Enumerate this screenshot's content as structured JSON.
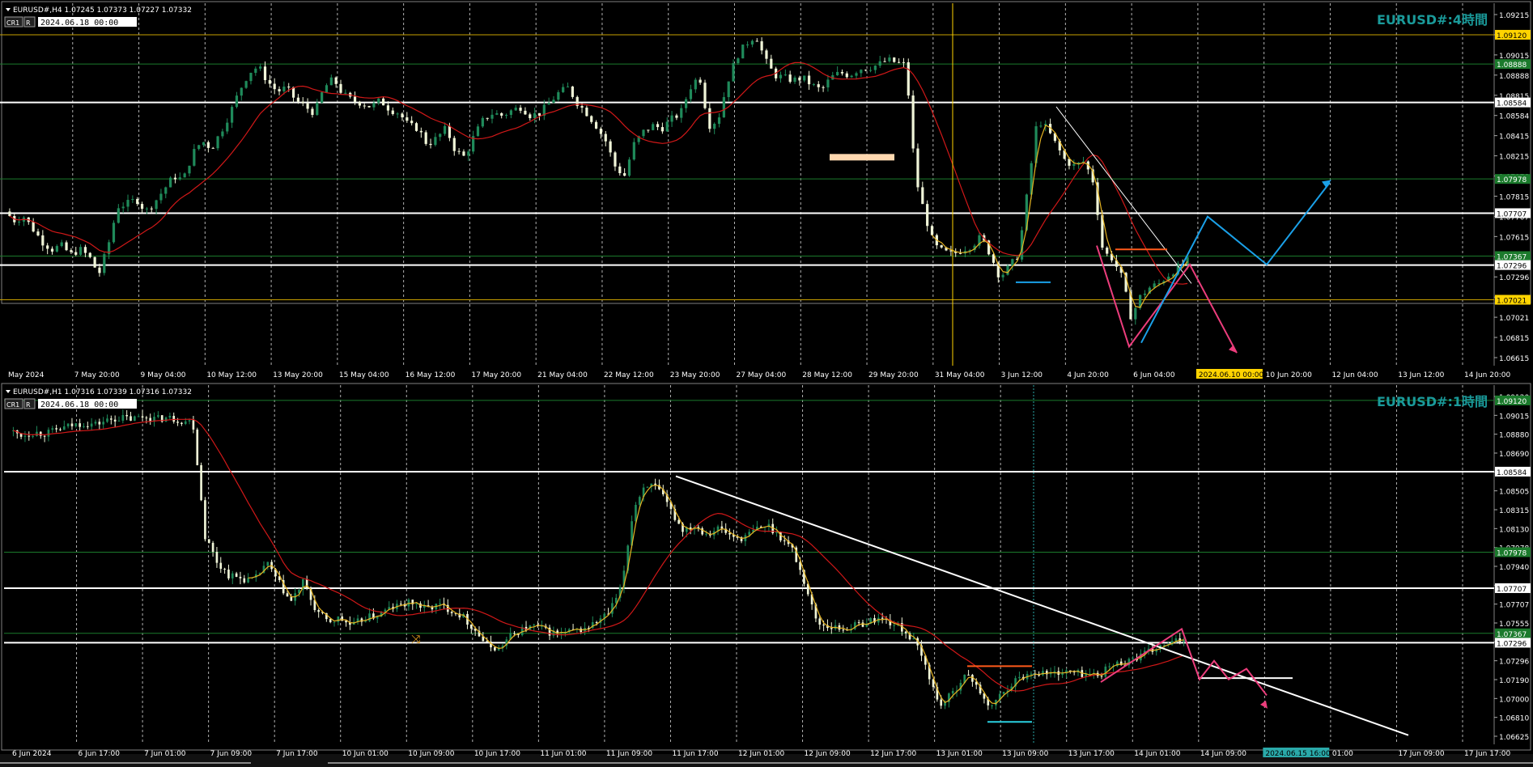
{
  "colors": {
    "background": "#000000",
    "grid": "#cfcfcf",
    "bull": "#1f8a5a",
    "bear": "#f0f5d8",
    "ma_red": "#d01818",
    "zigzag": "#e6b422",
    "level_white": "#ffffff",
    "level_green": "#1b7a2c",
    "level_yellow": "#c8a000",
    "arrow_blue": "#1aa0e8",
    "arrow_pink": "#ec3d7c",
    "orange_line": "#ff5a1a",
    "title_teal": "#1a9a9a",
    "rect_peach": "#ffd8b0"
  },
  "panels": [
    {
      "id": "h4",
      "info": "EURUSD#,H4  1.07245 1.07373 1.07227 1.07332",
      "buttons": [
        "CR1",
        "R"
      ],
      "date_box": "2024.06.18 00:00",
      "title": "EURUSD#:4時間",
      "price_labels": [
        "1.09215",
        "1.09120",
        "1.09015",
        "1.08888",
        "1.08815",
        "1.08584",
        "1.08415",
        "1.08215",
        "1.07978",
        "1.07815",
        "1.07707",
        "1.07615",
        "1.07415",
        "1.07296",
        "1.07215",
        "1.07021",
        "1.06815",
        "1.06615"
      ],
      "time_labels": [
        "May 2024",
        "7 May 20:00",
        "9 May 04:00",
        "10 May 12:00",
        "13 May 20:00",
        "15 May 04:00",
        "16 May 12:00",
        "17 May 20:00",
        "21 May 04:00",
        "22 May 12:00",
        "23 May 20:00",
        "27 May 04:00",
        "28 May 12:00",
        "29 May 20:00",
        "31 May 04:00",
        "3 Jun 12:00",
        "4 Jun 20:00",
        "6 Jun 04:00",
        "2024.06.10 00:00",
        "10 Jun 20:00",
        "12 Jun 04:00",
        "13 Jun 12:00",
        "14 Jun 20:00"
      ],
      "chart_data": {
        "type": "candlestick",
        "symbol": "EURUSD#",
        "timeframe": "H4",
        "ylim": [
          1.0655,
          1.0928
        ],
        "levels": [
          {
            "price": 1.0912,
            "style": "yellow",
            "label": "1.09120"
          },
          {
            "price": 1.08888,
            "style": "green",
            "label": "1.08888"
          },
          {
            "price": 1.08584,
            "style": "white",
            "label": "1.08584"
          },
          {
            "price": 1.07978,
            "style": "green",
            "label": "1.07978"
          },
          {
            "price": 1.07707,
            "style": "white",
            "label": "1.07707"
          },
          {
            "price": 1.07367,
            "style": "green",
            "label": "1.07367"
          },
          {
            "price": 1.07296,
            "style": "white",
            "label": "1.07296"
          },
          {
            "price": 1.07021,
            "style": "yellow",
            "label": "1.07021"
          }
        ],
        "close_path": [
          1.0772,
          1.0765,
          1.0768,
          1.0758,
          1.0748,
          1.0742,
          1.0745,
          1.0738,
          1.0742,
          1.0736,
          1.0722,
          1.0745,
          1.0776,
          1.0778,
          1.0782,
          1.0772,
          1.078,
          1.079,
          1.08,
          1.0797,
          1.0818,
          1.0828,
          1.0822,
          1.0835,
          1.085,
          1.0868,
          1.0882,
          1.0887,
          1.0875,
          1.0867,
          1.087,
          1.086,
          1.0855,
          1.085,
          1.087,
          1.0877,
          1.0865,
          1.086,
          1.0858,
          1.0855,
          1.086,
          1.0853,
          1.085,
          1.084,
          1.0838,
          1.0825,
          1.083,
          1.0838,
          1.082,
          1.0815,
          1.0832,
          1.0845,
          1.085,
          1.0848,
          1.0852,
          1.0855,
          1.0848,
          1.085,
          1.0858,
          1.0866,
          1.087,
          1.0858,
          1.085,
          1.084,
          1.0828,
          1.0808,
          1.08,
          1.0825,
          1.0835,
          1.084,
          1.0838,
          1.0845,
          1.085,
          1.087,
          1.088,
          1.084,
          1.0845,
          1.0875,
          1.0895,
          1.0905,
          1.0912,
          1.0892,
          1.088,
          1.0878,
          1.0876,
          1.0878,
          1.0872,
          1.0868,
          1.0878,
          1.0882,
          1.088,
          1.0885,
          1.0886,
          1.0888,
          1.0892,
          1.089,
          1.0888,
          1.08,
          1.077,
          1.0745,
          1.074,
          1.0738,
          1.0742,
          1.0745,
          1.0752,
          1.0738,
          1.072,
          1.0728,
          1.0738,
          1.079,
          1.0845,
          1.0838,
          1.0825,
          1.0812,
          1.0808,
          1.0812,
          1.0795,
          1.074,
          1.0735,
          1.072,
          1.0688,
          1.0705,
          1.0712,
          1.0715,
          1.0722,
          1.0728,
          1.0733
        ]
      }
    },
    {
      "id": "h1",
      "info": "EURUSD#,H1  1.07316 1.07339 1.07316 1.07332",
      "buttons": [
        "CR1",
        "R"
      ],
      "date_box": "2024.06.18 00:00",
      "title": "EURUSD#:1時間",
      "price_labels": [
        "1.09120",
        "1.09015",
        "1.08880",
        "1.08690",
        "1.08584",
        "1.08505",
        "1.08315",
        "1.08130",
        "1.07978",
        "1.07940",
        "1.07750",
        "1.07707",
        "1.07555",
        "1.07367",
        "1.07296",
        "1.07190",
        "1.07000",
        "1.06810",
        "1.06625"
      ],
      "time_labels": [
        "6 Jun 2024",
        "6 Jun 17:00",
        "7 Jun 01:00",
        "7 Jun 09:00",
        "7 Jun 17:00",
        "10 Jun 01:00",
        "10 Jun 09:00",
        "10 Jun 17:00",
        "11 Jun 01:00",
        "11 Jun 09:00",
        "11 Jun 17:00",
        "12 Jun 01:00",
        "12 Jun 09:00",
        "12 Jun 17:00",
        "13 Jun 01:00",
        "13 Jun 09:00",
        "13 Jun 17:00",
        "14 Jun 01:00",
        "14 Jun 09:00",
        "2024.06.15 16:00",
        "01:00",
        "17 Jun 09:00",
        "17 Jun 17:00"
      ],
      "chart_data": {
        "type": "candlestick",
        "symbol": "EURUSD#",
        "timeframe": "H1",
        "ylim": [
          1.0658,
          1.0915
        ],
        "levels": [
          {
            "price": 1.0912,
            "style": "green",
            "label": "1.09120"
          },
          {
            "price": 1.08584,
            "style": "white",
            "label": "1.08584"
          },
          {
            "price": 1.07978,
            "style": "green",
            "label": "1.07978"
          },
          {
            "price": 1.07707,
            "style": "white",
            "label": "1.07707"
          },
          {
            "price": 1.07367,
            "style": "green",
            "label": "1.07367"
          },
          {
            "price": 1.07296,
            "style": "white",
            "label": "1.07296"
          }
        ],
        "close_path": [
          1.0889,
          1.0886,
          1.0888,
          1.0887,
          1.089,
          1.0893,
          1.0895,
          1.0894,
          1.0897,
          1.0899,
          1.0898,
          1.09,
          1.0898,
          1.0899,
          1.0897,
          1.0896,
          1.081,
          1.079,
          1.078,
          1.0778,
          1.0776,
          1.079,
          1.0775,
          1.076,
          1.0775,
          1.0755,
          1.0745,
          1.0748,
          1.0742,
          1.0748,
          1.075,
          1.0755,
          1.0758,
          1.076,
          1.0755,
          1.0758,
          1.0755,
          1.075,
          1.074,
          1.0728,
          1.0725,
          1.0735,
          1.074,
          1.0742,
          1.0738,
          1.0736,
          1.0738,
          1.074,
          1.0745,
          1.0752,
          1.077,
          1.083,
          1.085,
          1.0845,
          1.083,
          1.0815,
          1.0818,
          1.0812,
          1.0816,
          1.081,
          1.0808,
          1.0815,
          1.0818,
          1.081,
          1.08,
          1.0775,
          1.0745,
          1.0742,
          1.074,
          1.0742,
          1.0745,
          1.0748,
          1.0745,
          1.074,
          1.073,
          1.071,
          1.0682,
          1.069,
          1.0705,
          1.07,
          1.068,
          1.069,
          1.07,
          1.0705,
          1.0708,
          1.0706,
          1.0708,
          1.0707,
          1.0706,
          1.0705,
          1.0712,
          1.0715,
          1.0718,
          1.0722,
          1.0726,
          1.0729,
          1.0733
        ]
      }
    }
  ]
}
